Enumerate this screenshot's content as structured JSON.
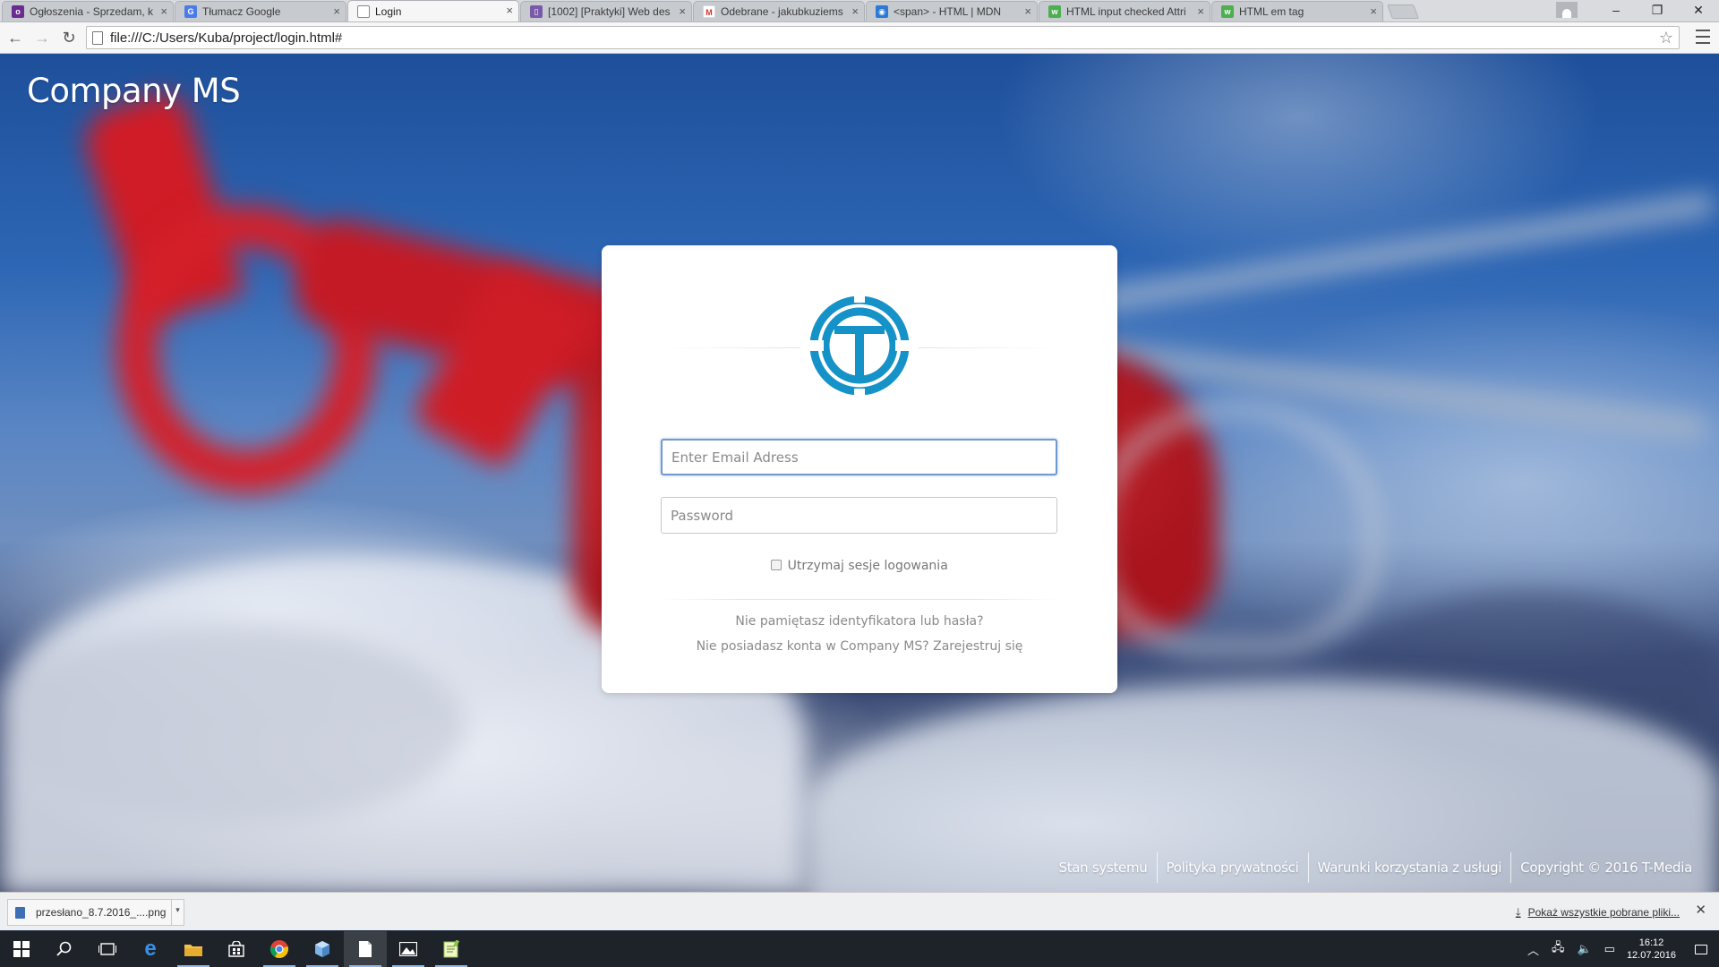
{
  "browser": {
    "tabs": [
      {
        "title": "Ogłoszenia - Sprzedam, k",
        "favicon": "olx-icon",
        "color": "#6a2c91"
      },
      {
        "title": "Tłumacz Google",
        "favicon": "google-translate-icon",
        "color": "#4a7be8"
      },
      {
        "title": "Login",
        "favicon": "page-icon",
        "color": "#ffffff"
      },
      {
        "title": "[1002] [Praktyki] Web des",
        "favicon": "tracker-icon",
        "color": "#7a5aa8"
      },
      {
        "title": "Odebrane - jakubkuziems",
        "favicon": "gmail-icon",
        "color": "#d93025"
      },
      {
        "title": "<span> - HTML | MDN",
        "favicon": "mdn-icon",
        "color": "#2a7ad6"
      },
      {
        "title": "HTML input checked Attri",
        "favicon": "w3schools-icon",
        "color": "#4caf50"
      },
      {
        "title": "HTML em tag",
        "favicon": "w3schools-icon",
        "color": "#4caf50"
      }
    ],
    "url": "file:///C:/Users/Kuba/project/login.html#"
  },
  "page": {
    "brand": "Company MS",
    "login": {
      "email_placeholder": "Enter Email Adress",
      "password_placeholder": "Password",
      "remember_label": "Utrzymaj sesje logowania",
      "forgot_link": "Nie pamiętasz identyfikatora lub hasła?",
      "register_link": "Nie posiadasz konta w Company MS? Zarejestruj się",
      "logo_color": "#1592c8"
    },
    "footer": {
      "links": [
        "Stan systemu",
        "Polityka prywatności",
        "Warunki korzystania z usługi",
        "Copyright © 2016 T-Media"
      ]
    }
  },
  "downloads": {
    "item": "przesłano_8.7.2016_....png",
    "show_all": "Pokaż wszystkie pobrane pliki..."
  },
  "taskbar": {
    "time": "16:12",
    "date": "12.07.2016"
  }
}
